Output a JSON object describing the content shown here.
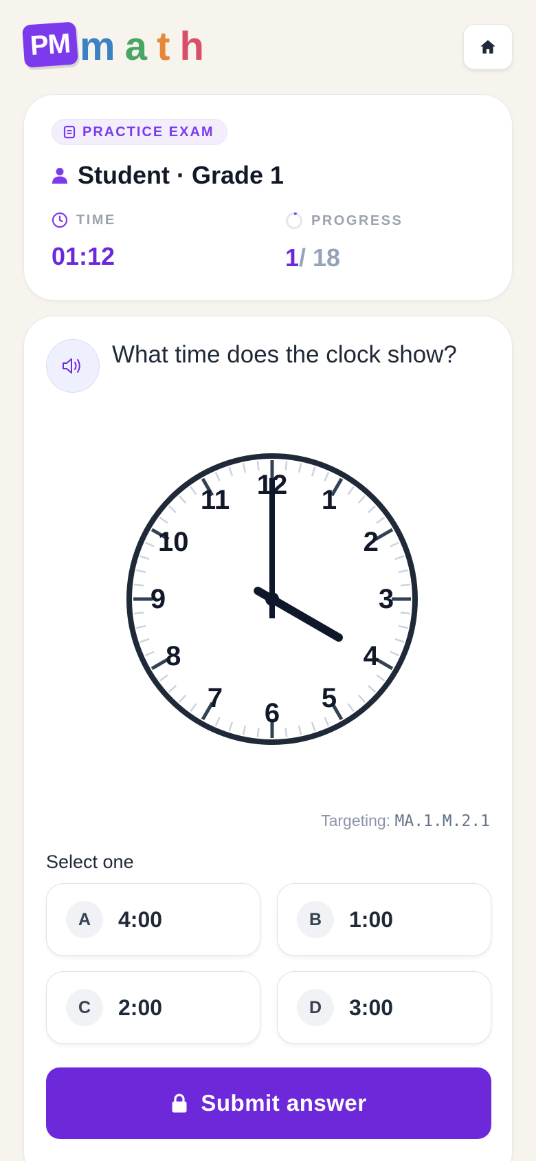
{
  "header": {
    "logo_badge": "PM",
    "logo_word": [
      "m",
      "a",
      "t",
      "h"
    ],
    "home_icon": "home-icon"
  },
  "info": {
    "badge": "PRACTICE EXAM",
    "student": "Student · Grade 1",
    "time_label": "TIME",
    "time_value": "01:12",
    "progress_label": "PROGRESS",
    "progress_current": "1",
    "progress_total": "/ 18",
    "progress_fraction": 0.0556
  },
  "question": {
    "text": "What time does the clock show?",
    "clock": {
      "hour": 4,
      "minute": 0,
      "numbers": [
        "12",
        "1",
        "2",
        "3",
        "4",
        "5",
        "6",
        "7",
        "8",
        "9",
        "10",
        "11"
      ]
    },
    "targeting_label": "Targeting:",
    "targeting_code": "MA.1.M.2.1",
    "select_label": "Select one",
    "choices": [
      {
        "letter": "A",
        "value": "4:00"
      },
      {
        "letter": "B",
        "value": "1:00"
      },
      {
        "letter": "C",
        "value": "2:00"
      },
      {
        "letter": "D",
        "value": "3:00"
      }
    ],
    "submit_label": "Submit answer"
  },
  "colors": {
    "accent": "#6d28d9",
    "background": "#f7f3ed",
    "clock_dark": "#1f2937",
    "tick_light": "#cbd2e1"
  }
}
